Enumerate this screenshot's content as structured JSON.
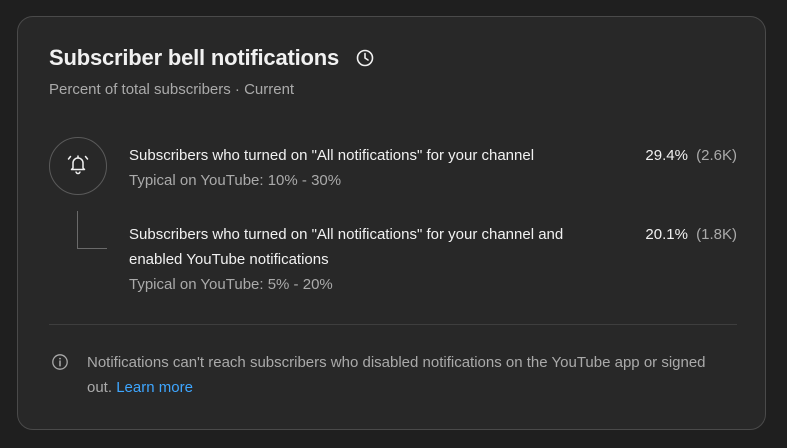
{
  "card": {
    "title": "Subscriber bell notifications",
    "title_icon": "clock-icon",
    "subtitle": "Percent of total subscribers · Current"
  },
  "rows": [
    {
      "label": "Subscribers who turned on \"All notifications\" for your channel",
      "percent": "29.4%",
      "count": "(2.6K)",
      "typical": "Typical on YouTube: 10% - 30%"
    },
    {
      "label": "Subscribers who turned on \"All notifications\" for your channel and enabled YouTube notifications",
      "percent": "20.1%",
      "count": "(1.8K)",
      "typical": "Typical on YouTube: 5% - 20%"
    }
  ],
  "icons": {
    "bell": "bell-ringing-icon",
    "info": "info-icon"
  },
  "footer": {
    "text": "Notifications can't reach subscribers who disabled notifications on the YouTube app or signed out.",
    "link": "Learn more"
  },
  "colors": {
    "background": "#1f1f1f",
    "card": "#282828",
    "text_primary": "#f1f1f1",
    "text_secondary": "#aaaaaa",
    "link": "#3ea6ff"
  }
}
